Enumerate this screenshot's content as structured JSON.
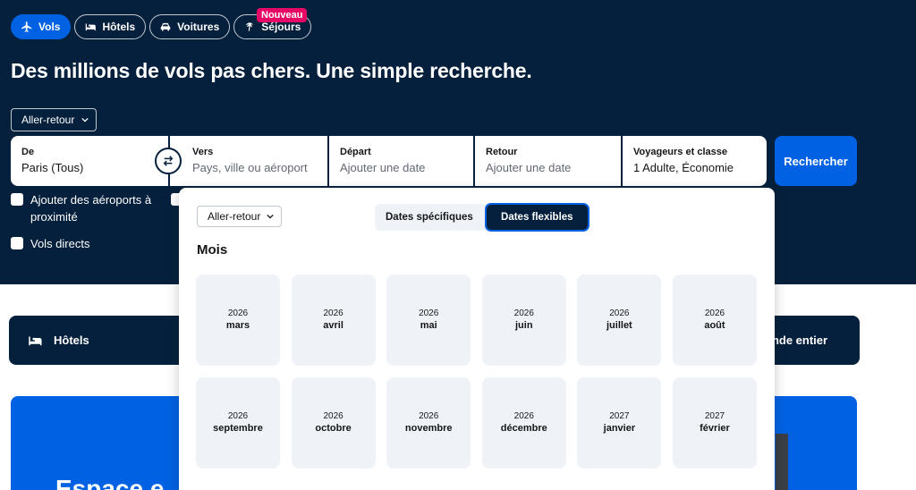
{
  "tabs": [
    {
      "label": "Vols",
      "icon": "plane-icon",
      "active": true
    },
    {
      "label": "Hôtels",
      "icon": "bed-icon",
      "active": false
    },
    {
      "label": "Voitures",
      "icon": "car-icon",
      "active": false
    },
    {
      "label": "Séjours",
      "icon": "palm-tree-icon",
      "active": false
    }
  ],
  "new_badge": "Nouveau",
  "headline": "Des millions de vols pas chers. Une simple recherche.",
  "trip_type": "Aller-retour",
  "search": {
    "from_label": "De",
    "from_value": "Paris (Tous)",
    "to_label": "Vers",
    "to_placeholder": "Pays, ville ou aéroport",
    "depart_label": "Départ",
    "depart_placeholder": "Ajouter une date",
    "return_label": "Retour",
    "return_placeholder": "Ajouter une date",
    "travellers_label": "Voyageurs et classe",
    "travellers_value": "1 Adulte, Économie",
    "button": "Rechercher"
  },
  "options": {
    "nearby_line1": "Ajouter des aéroports à",
    "nearby_line2": "proximité",
    "direct": "Vols directs"
  },
  "cards": {
    "hotels": "Hôtels",
    "world": "onde entier"
  },
  "banner_text": "Espace e",
  "flex_dates": {
    "trip_type": "Aller-retour",
    "tab_specific": "Dates spécifiques",
    "tab_flexible": "Dates flexibles",
    "section_title": "Mois",
    "months": [
      {
        "year": "2026",
        "month": "mars"
      },
      {
        "year": "2026",
        "month": "avril"
      },
      {
        "year": "2026",
        "month": "mai"
      },
      {
        "year": "2026",
        "month": "juin"
      },
      {
        "year": "2026",
        "month": "juillet"
      },
      {
        "year": "2026",
        "month": "août"
      },
      {
        "year": "2026",
        "month": "septembre"
      },
      {
        "year": "2026",
        "month": "octobre"
      },
      {
        "year": "2026",
        "month": "novembre"
      },
      {
        "year": "2026",
        "month": "décembre"
      },
      {
        "year": "2027",
        "month": "janvier"
      },
      {
        "year": "2027",
        "month": "février"
      }
    ]
  },
  "colors": {
    "navy": "#05203c",
    "blue": "#0062e3",
    "badge": "#e70866",
    "tile": "#eff3f8"
  }
}
